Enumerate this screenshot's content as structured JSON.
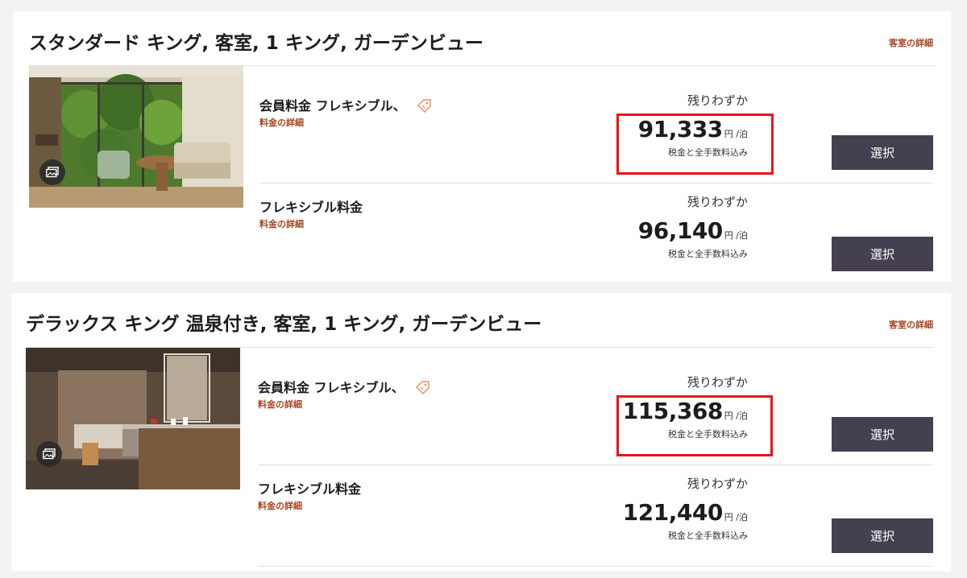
{
  "rooms": [
    {
      "title": "スタンダード キング, 客室, 1 キング, ガーデンビュー",
      "details_link": "客室の詳細",
      "rates": [
        {
          "name": "会員料金 フレキシブル、",
          "details_link": "料金の詳細",
          "availability": "残りわずか",
          "price": "91,333",
          "unit": "円 /泊",
          "tax_note": "税金と全手数料込み",
          "select_label": "選択",
          "has_tag_icon": true
        },
        {
          "name": "フレキシブル料金",
          "details_link": "料金の詳細",
          "availability": "残りわずか",
          "price": "96,140",
          "unit": "円 /泊",
          "tax_note": "税金と全手数料込み",
          "select_label": "選択",
          "has_tag_icon": false
        }
      ]
    },
    {
      "title": "デラックス キング 温泉付き, 客室, 1 キング, ガーデンビュー",
      "details_link": "客室の詳細",
      "rates": [
        {
          "name": "会員料金 フレキシブル、",
          "details_link": "料金の詳細",
          "availability": "残りわずか",
          "price": "115,368",
          "unit": "円 /泊",
          "tax_note": "税金と全手数料込み",
          "select_label": "選択",
          "has_tag_icon": true
        },
        {
          "name": "フレキシブル料金",
          "details_link": "料金の詳細",
          "availability": "残りわずか",
          "price": "121,440",
          "unit": "円 /泊",
          "tax_note": "税金と全手数料込み",
          "select_label": "選択",
          "has_tag_icon": false
        }
      ]
    }
  ],
  "icons": {
    "gallery": "gallery-icon",
    "tag": "tag-icon"
  },
  "colors": {
    "accent_link": "#a4441f",
    "select_button_bg": "#45404f",
    "highlight_border": "#e8141a",
    "tag_icon": "#f08a5d"
  }
}
